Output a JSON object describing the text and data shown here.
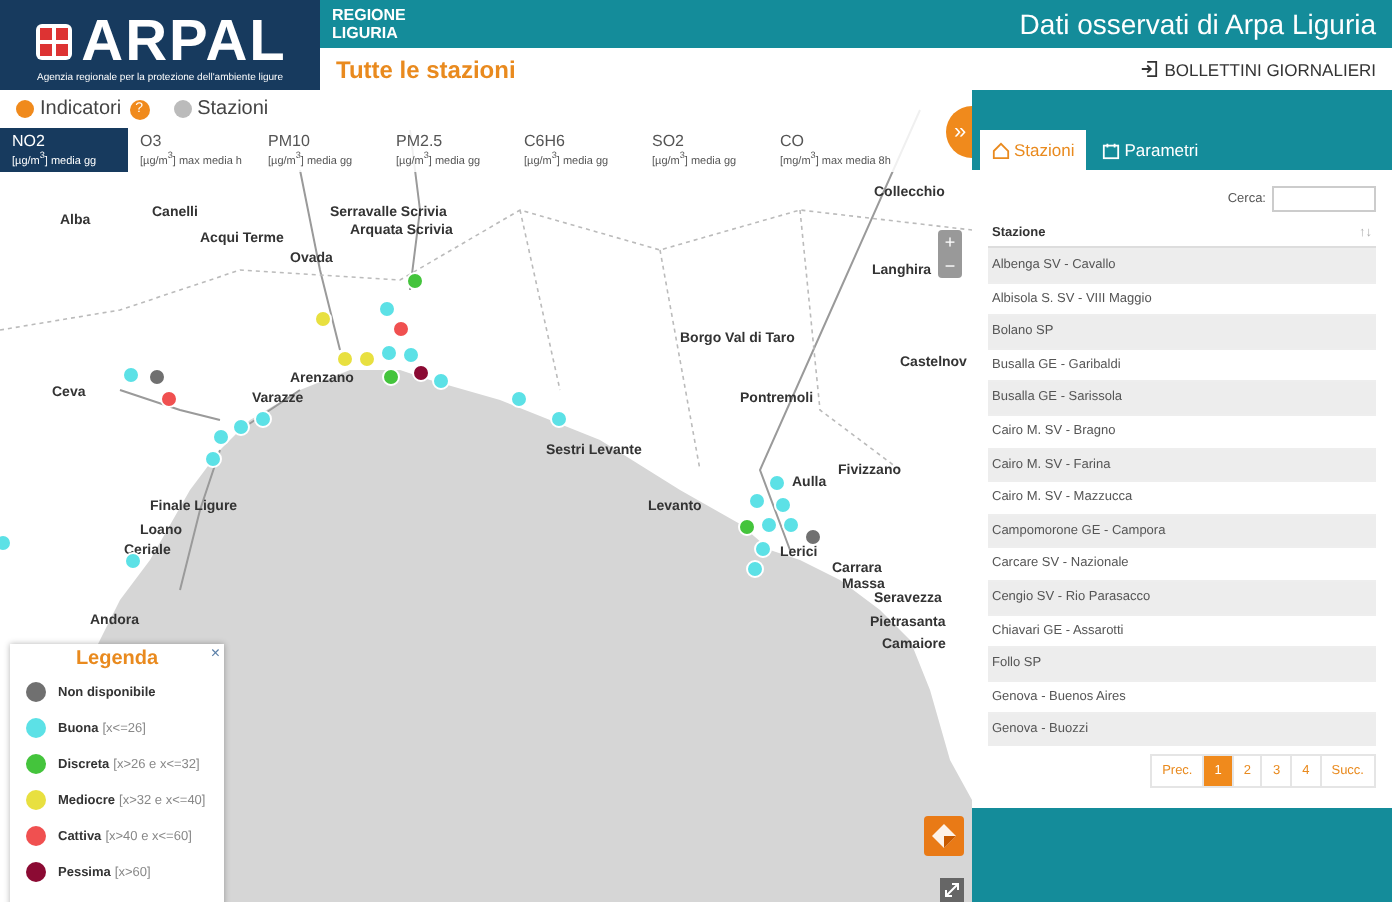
{
  "header": {
    "logo_text": "ARPAL",
    "logo_tagline": "Agenzia regionale per la protezione dell'ambiente ligure",
    "region": "REGIONE\nLIGURIA",
    "title": "Dati osservati di Arpa Liguria",
    "subtitle": "Tutte le stazioni",
    "bulletin_link": "BOLLETTINI GIORNALIERI"
  },
  "view_toggle": [
    {
      "label": "Indicatori",
      "selected": true,
      "help": "?"
    },
    {
      "label": "Stazioni",
      "selected": false
    }
  ],
  "pollutants": [
    {
      "name": "NO2",
      "unit": "[µg/m$^{3}$] media gg",
      "selected": true
    },
    {
      "name": "O3",
      "unit": "[µg/m$^{3}$] max media h",
      "selected": false
    },
    {
      "name": "PM10",
      "unit": "[µg/m$^{3}$] media gg",
      "selected": false
    },
    {
      "name": "PM2.5",
      "unit": "[µg/m$^{3}$] media gg",
      "selected": false
    },
    {
      "name": "C6H6",
      "unit": "[µg/m$^{3}$] media gg",
      "selected": false
    },
    {
      "name": "SO2",
      "unit": "[µg/m$^{3}$] media gg",
      "selected": false
    },
    {
      "name": "CO",
      "unit": "[mg/m$^{3}$] max media 8h",
      "selected": false
    }
  ],
  "map": {
    "places": [
      "Collecchio",
      "Alba",
      "Canelli",
      "Acqui Terme",
      "Ovada",
      "Serravalle Scrivia",
      "Arquata Scrivia",
      "Borgo Val di Taro",
      "Langhira",
      "Castelnov",
      "Ceva",
      "Arenzano",
      "Varazze",
      "Pontremoli",
      "Sestri Levante",
      "Fivizzano",
      "Aulla",
      "Finale Ligure",
      "Levanto",
      "Loano",
      "Ceriale",
      "Lerici",
      "Carrara",
      "Massa",
      "Seravezza",
      "Pietrasanta",
      "Andora",
      "Camaiore"
    ],
    "markers": [
      {
        "color": "#5ce1e6"
      },
      {
        "color": "#707070"
      },
      {
        "color": "#f05050"
      },
      {
        "color": "#5ce1e6"
      },
      {
        "color": "#5ce1e6"
      },
      {
        "color": "#5ce1e6"
      },
      {
        "color": "#5ce1e6"
      },
      {
        "color": "#e8e040"
      },
      {
        "color": "#5ce1e6"
      },
      {
        "color": "#44c43c"
      },
      {
        "color": "#f05050"
      },
      {
        "color": "#e8e040"
      },
      {
        "color": "#e8e040"
      },
      {
        "color": "#5ce1e6"
      },
      {
        "color": "#5ce1e6"
      },
      {
        "color": "#44c43c"
      },
      {
        "color": "#8b0a33"
      },
      {
        "color": "#5ce1e6"
      },
      {
        "color": "#5ce1e6"
      },
      {
        "color": "#5ce1e6"
      },
      {
        "color": "#5ce1e6"
      },
      {
        "color": "#5ce1e6"
      },
      {
        "color": "#5ce1e6"
      },
      {
        "color": "#5ce1e6"
      },
      {
        "color": "#5ce1e6"
      },
      {
        "color": "#44c43c"
      },
      {
        "color": "#707070"
      },
      {
        "color": "#5ce1e6"
      },
      {
        "color": "#5ce1e6"
      },
      {
        "color": "#5ce1e6"
      },
      {
        "color": "#5ce1e6"
      }
    ]
  },
  "legend": {
    "title": "Legenda",
    "close": "×",
    "items": [
      {
        "name": "Non disponibile",
        "color": "#707070"
      },
      {
        "name": "Buona",
        "range": "[x<=26]",
        "color": "#5ce1e6"
      },
      {
        "name": "Discreta",
        "range": "[x>26 e x<=32]",
        "color": "#44c43c"
      },
      {
        "name": "Mediocre",
        "range": "[x>32 e x<=40]",
        "color": "#e8e040"
      },
      {
        "name": "Cattiva",
        "range": "[x>40 e x<=60]",
        "color": "#f05050"
      },
      {
        "name": "Pessima",
        "range": "[x>60]",
        "color": "#8b0a33"
      }
    ]
  },
  "zoom_controls": [
    "+",
    "−"
  ],
  "panel": {
    "toggle": "»",
    "tabs": [
      {
        "label": "Stazioni",
        "selected": true
      },
      {
        "label": "Parametri",
        "selected": false
      }
    ],
    "search_label": "Cerca:",
    "column": "Stazione",
    "sort": "↑↓",
    "rows": [
      "Albenga SV - Cavallo",
      "Albisola S. SV - VIII Maggio",
      "Bolano SP",
      "Busalla GE - Garibaldi",
      "Busalla GE - Sarissola",
      "Cairo M. SV - Bragno",
      "Cairo M. SV - Farina",
      "Cairo M. SV - Mazzucca",
      "Campomorone GE - Campora",
      "Carcare SV - Nazionale",
      "Cengio SV - Rio Parasacco",
      "Chiavari GE - Assarotti",
      "Follo SP",
      "Genova - Buenos Aires",
      "Genova - Buozzi"
    ],
    "pagination": [
      {
        "label": "Prec.",
        "selected": false
      },
      {
        "label": "1",
        "selected": true
      },
      {
        "label": "2",
        "selected": false
      },
      {
        "label": "3",
        "selected": false
      },
      {
        "label": "4",
        "selected": false
      },
      {
        "label": "Succ.",
        "selected": false
      }
    ]
  }
}
